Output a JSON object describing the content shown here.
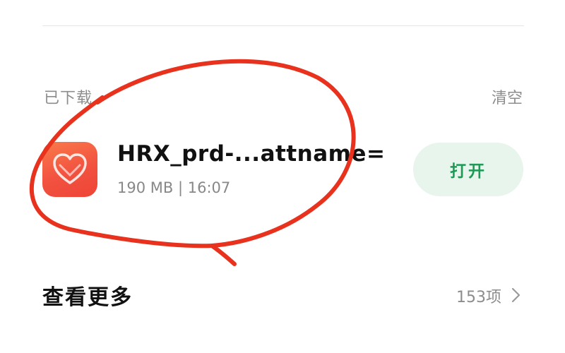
{
  "downloaded_section": {
    "title": "已下载",
    "clear_label": "清空"
  },
  "download_item": {
    "icon": "heart-app-icon",
    "file_name": "HRX_prd-...attname=",
    "file_size": "190 MB",
    "separator": "|",
    "time": "16:07",
    "open_label": "打开"
  },
  "more": {
    "title": "查看更多",
    "count": "153项",
    "icon": "chevron-right-icon"
  },
  "colors": {
    "icon_gradient": "#f25240",
    "open_button_bg": "#e7f5ec",
    "open_button_text": "#1d9a55",
    "annotation": "#e8321e"
  }
}
